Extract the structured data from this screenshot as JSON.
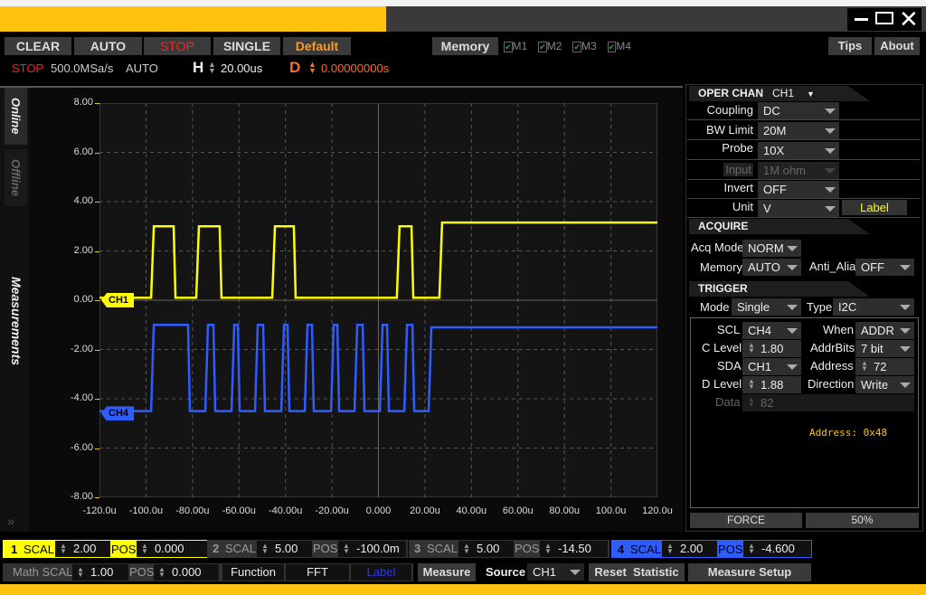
{
  "window": {
    "controls": [
      "minimize",
      "maximize",
      "close"
    ],
    "accent": "#ffc20e"
  },
  "toolbar": {
    "clear": "CLEAR",
    "auto": "AUTO",
    "stop": "STOP",
    "single": "SINGLE",
    "default": "Default",
    "memory": "Memory",
    "mems": [
      "M1",
      "M2",
      "M3",
      "M4"
    ],
    "tips": "Tips",
    "about": "About"
  },
  "status": {
    "state": "STOP",
    "rate": "500.0MSa/s",
    "mode": "AUTO",
    "h_label": "H",
    "h_value": "20.00us",
    "d_label": "D",
    "d_value": "0.00000000s"
  },
  "side_tabs": {
    "online": "Online",
    "offline": "Offline",
    "measurements": "Measurements"
  },
  "chart_data": {
    "type": "line",
    "x_ticks": [
      "-120.0u",
      "-100.0u",
      "-80.00u",
      "-60.00u",
      "-40.00u",
      "-20.00u",
      "0.000",
      "20.00u",
      "40.00u",
      "60.00u",
      "80.00u",
      "100.0u",
      "120.0u"
    ],
    "y_ticks": [
      "8.00",
      "6.00",
      "4.00",
      "2.00",
      "0.00",
      "-2.00",
      "-4.00",
      "-6.00",
      "-8.00"
    ],
    "xlim_us": [
      -120,
      120
    ],
    "ylim": [
      -8,
      8
    ],
    "grid": true,
    "series": [
      {
        "name": "CH1",
        "color": "#ffff00",
        "low": 0.1,
        "high": 3.0,
        "final_high": 3.15,
        "start": "low",
        "edges_us": [
          -97.4,
          -87.7,
          -78,
          -67.9,
          -45.3,
          -36,
          8.3,
          14.6,
          26.6
        ]
      },
      {
        "name": "CH4",
        "color": "#2f5cff",
        "low": -4.5,
        "high": -1.0,
        "final_high": -1.1,
        "start": "low",
        "edges_us": [
          -97.4,
          -81.5,
          -74.1,
          -70.6,
          -62.8,
          -60.1,
          -52.7,
          -49.2,
          -41.4,
          -38.7,
          -31.3,
          -28.2,
          -20.0,
          -17.3,
          -9.9,
          -6.4,
          1.0,
          4.1,
          11.5,
          15.0,
          22.0
        ]
      }
    ],
    "markers": [
      {
        "label": "CH1",
        "level": 0.0
      },
      {
        "label": "CH4",
        "level": -4.6
      }
    ]
  },
  "oper": {
    "title": "OPER CHAN",
    "chan": "CH1",
    "coupling_l": "Coupling",
    "coupling": "DC",
    "bw_l": "BW Limit",
    "bw": "20M",
    "probe_l": "Probe",
    "probe": "10X",
    "input_l": "Input",
    "input": "1M ohm",
    "invert_l": "Invert",
    "invert": "OFF",
    "unit_l": "Unit",
    "unit": "V",
    "label_btn": "Label"
  },
  "acquire": {
    "title": "ACQUIRE",
    "acq_l": "Acq Mode",
    "acq": "NORM",
    "mem_l": "Memory",
    "mem": "AUTO",
    "anti_l": "Anti_Alia",
    "anti": "OFF"
  },
  "trigger": {
    "title": "TRIGGER",
    "mode_l": "Mode",
    "mode": "Single",
    "type_l": "Type",
    "type": "I2C",
    "scl_l": "SCL",
    "scl": "CH4",
    "when_l": "When",
    "when": "ADDR",
    "clev_l": "C Level",
    "clev": "1.80",
    "abits_l": "AddrBits",
    "abits": "7 bit",
    "sda_l": "SDA",
    "sda": "CH1",
    "addr_l": "Address",
    "addr": "72",
    "dlev_l": "D Level",
    "dlev": "1.88",
    "dir_l": "Direction",
    "dir": "Write",
    "data_l": "Data",
    "data": "82",
    "info": "Address: 0x48",
    "force": "FORCE",
    "fifty": "50%"
  },
  "channels": [
    {
      "n": "1",
      "scal_l": "SCAL",
      "scal": "2.00",
      "pos_l": "POS",
      "pos": "0.000",
      "color": "#ffff00"
    },
    {
      "n": "2",
      "scal_l": "SCAL",
      "scal": "5.00",
      "pos_l": "POS",
      "pos": "-100.0m"
    },
    {
      "n": "3",
      "scal_l": "SCAL",
      "scal": "5.00",
      "pos_l": "POS",
      "pos": "-14.50"
    },
    {
      "n": "4",
      "scal_l": "SCAL",
      "scal": "2.00",
      "pos_l": "POS",
      "pos": "-4.600",
      "color": "#2f5cff"
    }
  ],
  "math": {
    "scal_l": "Math SCAL",
    "scal": "1.00",
    "pos_l": "POS",
    "pos": "0.000",
    "function": "Function",
    "fft": "FFT",
    "label": "Label"
  },
  "measure": {
    "measure": "Measure",
    "source_l": "Source",
    "source": "CH1",
    "reset": "Reset  Statistic",
    "setup": "Measure Setup"
  }
}
